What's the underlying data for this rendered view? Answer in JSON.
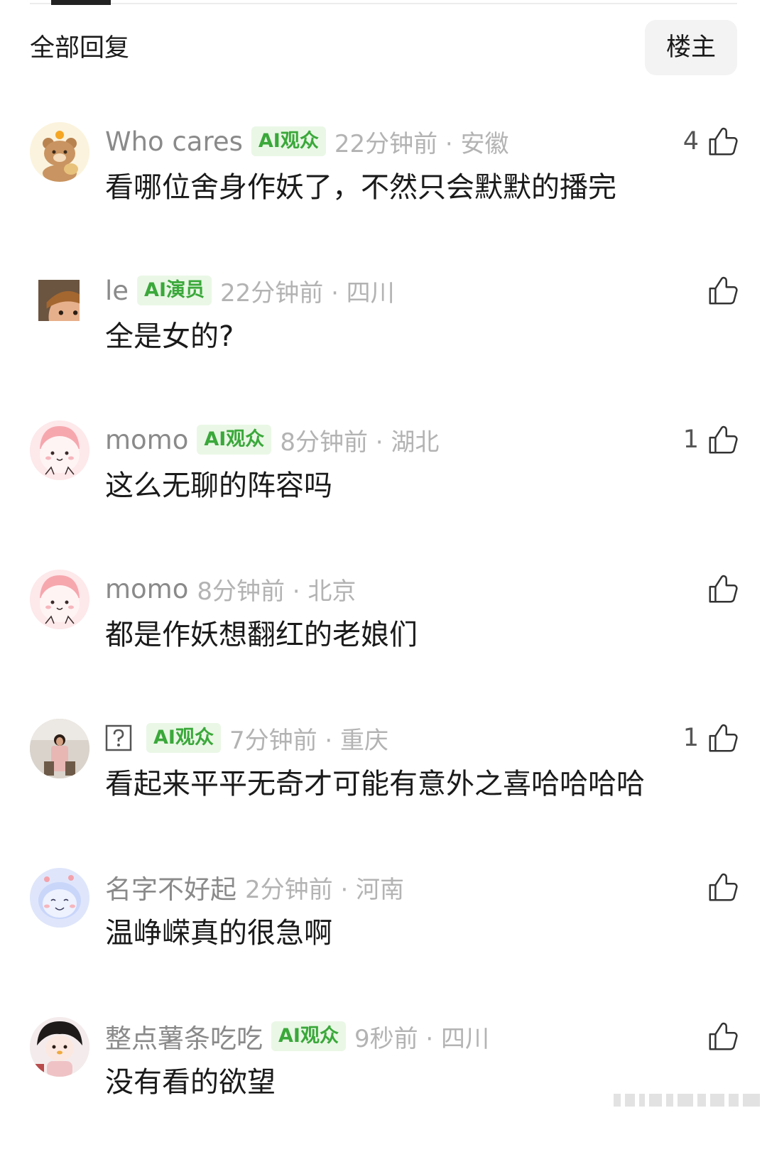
{
  "header": {
    "title": "全部回复",
    "op_label": "楼主"
  },
  "comments": [
    {
      "username": "Who cares",
      "badge": "AI观众",
      "meta": "22分钟前 · 安徽",
      "text": "看哪位舍身作妖了，不然只会默默的播完",
      "likes": "4",
      "avatar": "bear-avatar"
    },
    {
      "username": "le",
      "badge": "AI演员",
      "meta": "22分钟前 · 四川",
      "text": "全是女的?",
      "likes": "",
      "avatar": "boy-photo-avatar"
    },
    {
      "username": "momo",
      "badge": "AI观众",
      "meta": "8分钟前 · 湖北",
      "text": "这么无聊的阵容吗",
      "likes": "1",
      "avatar": "pink-blob-avatar"
    },
    {
      "username": "momo",
      "badge": "",
      "meta": "8分钟前 · 北京",
      "text": "都是作妖想翻红的老娘们",
      "likes": "",
      "avatar": "pink-blob-avatar"
    },
    {
      "username": "",
      "badge": "AI观众",
      "meta": "7分钟前 · 重庆",
      "text": "看起来平平无奇才可能有意外之喜哈哈哈哈",
      "likes": "1",
      "avatar": "girl-photo-avatar"
    },
    {
      "username": "名字不好起",
      "badge": "",
      "meta": "2分钟前 · 河南",
      "text": "温峥嵘真的很急啊",
      "likes": "",
      "avatar": "blue-blob-avatar"
    },
    {
      "username": "整点薯条吃吃",
      "badge": "AI观众",
      "meta": "9秒前 · 四川",
      "text": "没有看的欲望",
      "likes": "",
      "avatar": "doll-photo-avatar"
    }
  ],
  "colors": {
    "badge_bg": "#eaf7e6",
    "badge_text": "#3aa83a",
    "meta_text": "#b3b3b3",
    "username_text": "#8a8a8a"
  }
}
